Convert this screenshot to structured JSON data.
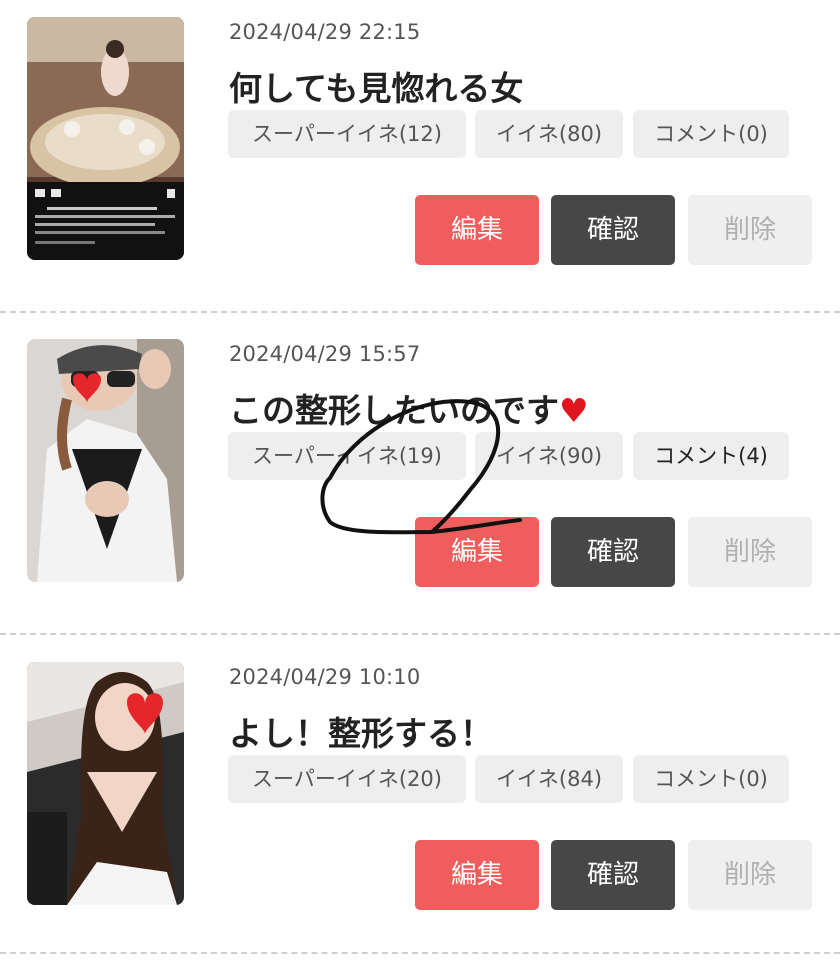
{
  "posts": [
    {
      "date": "2024/04/29 22:15",
      "title": "何しても見惚れる女",
      "title_heart": "",
      "super_iine": "スーパーイイネ(12)",
      "iine": "イイネ(80)",
      "comment": "コメント(0)",
      "edit": "編集",
      "confirm": "確認",
      "delete": "削除"
    },
    {
      "date": "2024/04/29 15:57",
      "title": "この整形したいのです",
      "title_heart": "♥",
      "super_iine": "スーパーイイネ(19)",
      "iine": "イイネ(90)",
      "comment": "コメント(4)",
      "edit": "編集",
      "confirm": "確認",
      "delete": "削除"
    },
    {
      "date": "2024/04/29 10:10",
      "title": "よし！整形する！",
      "title_heart": "",
      "super_iine": "スーパーイイネ(20)",
      "iine": "イイネ(84)",
      "comment": "コメント(0)",
      "edit": "編集",
      "confirm": "確認",
      "delete": "削除"
    }
  ],
  "colors": {
    "edit": "#ef5d5d",
    "confirm": "#474747",
    "delete": "#efefef",
    "tag": "#eeeeee",
    "heart": "#e0161e"
  }
}
